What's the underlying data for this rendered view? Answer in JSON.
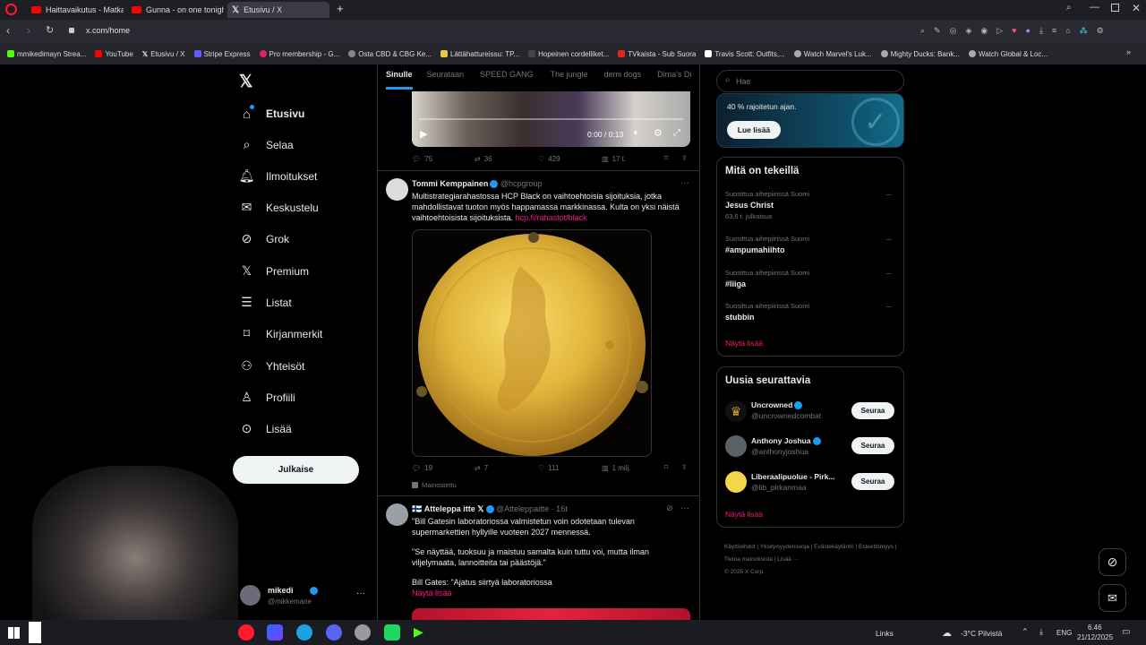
{
  "browser": {
    "tabs": [
      {
        "title": "Haittavaikutus - Matkalla"
      },
      {
        "title": "Gunna - on one tonight [O"
      },
      {
        "title": "Etusivu / X"
      }
    ],
    "url": "x.com/home",
    "bookmarks": [
      "mmikedimayn Strea...",
      "YouTube",
      "Etusivu / X",
      "Stripe Express",
      "Pro membership - G...",
      "Osta CBD & CBG Ke...",
      "Lättähattureissu: TP...",
      "Hopeinen cordelliket...",
      "TVkaista - Sub Suora",
      "Travis Scott: Outfits,...",
      "Watch Marvel's Luk...",
      "Mighty Ducks: Bank...",
      "Watch Global & Loc..."
    ]
  },
  "nav": {
    "items": [
      {
        "label": "Etusivu"
      },
      {
        "label": "Selaa"
      },
      {
        "label": "Ilmoitukset"
      },
      {
        "label": "Keskustelu"
      },
      {
        "label": "Grok"
      },
      {
        "label": "Premium"
      },
      {
        "label": "Listat"
      },
      {
        "label": "Kirjanmerkit"
      },
      {
        "label": "Yhteisöt"
      },
      {
        "label": "Profiili"
      },
      {
        "label": "Lisää"
      }
    ],
    "post_button": "Julkaise",
    "user": {
      "name": "mikedi",
      "handle": "@mikkemane"
    }
  },
  "feed": {
    "tabs": [
      "Sinulle",
      "Seurataan",
      "SPEED GANG",
      "The jungle",
      "demi dogs",
      "Dima's Di"
    ],
    "video_time": "0:00 / 0:13",
    "tweet0_stats": {
      "replies": "75",
      "retweets": "36",
      "likes": "429",
      "views": "17 t."
    },
    "tweet1": {
      "name": "Tommi Kemppainen",
      "handle": "@hcpgroup",
      "text": "Multistrategiarahastossa HCP Black on vaihtoehtoisia sijoituksia, jotka mahdollistavat tuoton myös happamassa markkinassa. Kulta on yksi näistä vaihtoehtoisista sijoituksista.",
      "link": "hcp.fi/rahastot/black",
      "stats": {
        "replies": "19",
        "retweets": "7",
        "likes": "111",
        "views": "1 milj."
      },
      "promoted": "Mainostettu"
    },
    "tweet2": {
      "name": "Atteleppa itte 𝕏",
      "handle": "@Atteleppaitte · 16t",
      "line1": "\"Bill Gatesin laboratoriossa valmistetun voin odotetaan tulevan supermarkettien hyllyille vuoteen 2027 mennessä.",
      "line2": "\"Se näyttää, tuoksuu ja maistuu samalta kuin tuttu voi, mutta ilman viljelymaata, lannoitteita tai päästöjä.\"",
      "line3": "Bill Gates: \"Ajatus siirtyä laboratoriossa",
      "more": "Näytä lisää"
    }
  },
  "right": {
    "search_placeholder": "Hae",
    "premium_text": "40 % rajoitetun ajan.",
    "premium_button": "Lue lisää",
    "trends_title": "Mitä on tekeillä",
    "trends": [
      {
        "context": "Suosittua aihepiirissä Suomi",
        "title": "Jesus Christ",
        "count": "63,6 t. julkaisua"
      },
      {
        "context": "Suosittua aihepiirissä Suomi",
        "title": "#ampumahiihto",
        "count": ""
      },
      {
        "context": "Suosittua aihepiirissä Suomi",
        "title": "#liiga",
        "count": ""
      },
      {
        "context": "Suosittua aihepiirissä Suomi",
        "title": "stubbin",
        "count": ""
      }
    ],
    "trends_more": "Näytä lisää",
    "who_title": "Uusia seurattavia",
    "who": [
      {
        "name": "Uncrowned",
        "handle": "@uncrownedcombat",
        "button": "Seuraa"
      },
      {
        "name": "Anthony Joshua",
        "handle": "@anthonyjoshua",
        "button": "Seuraa"
      },
      {
        "name": "Liberaalipuolue - Pirk...",
        "handle": "@lib_pirkanmaa",
        "button": "Seuraa"
      }
    ],
    "who_more": "Näytä lisää",
    "footer": [
      "Käyttöehdot",
      "Yksityisyydensuoja",
      "Evästekäytäntö",
      "Esteettömyys",
      "Tietoa mainoksista",
      "Lisää ···",
      "© 2025 X Corp."
    ]
  },
  "taskbar": {
    "links": "Links",
    "weather": "-3°C Pilvistä",
    "lang": "ENG",
    "time": "6.46",
    "date": "21/12/2025"
  },
  "colors": {
    "accent": "#1d9bf0",
    "link": "#f91880",
    "bg": "#000000"
  }
}
